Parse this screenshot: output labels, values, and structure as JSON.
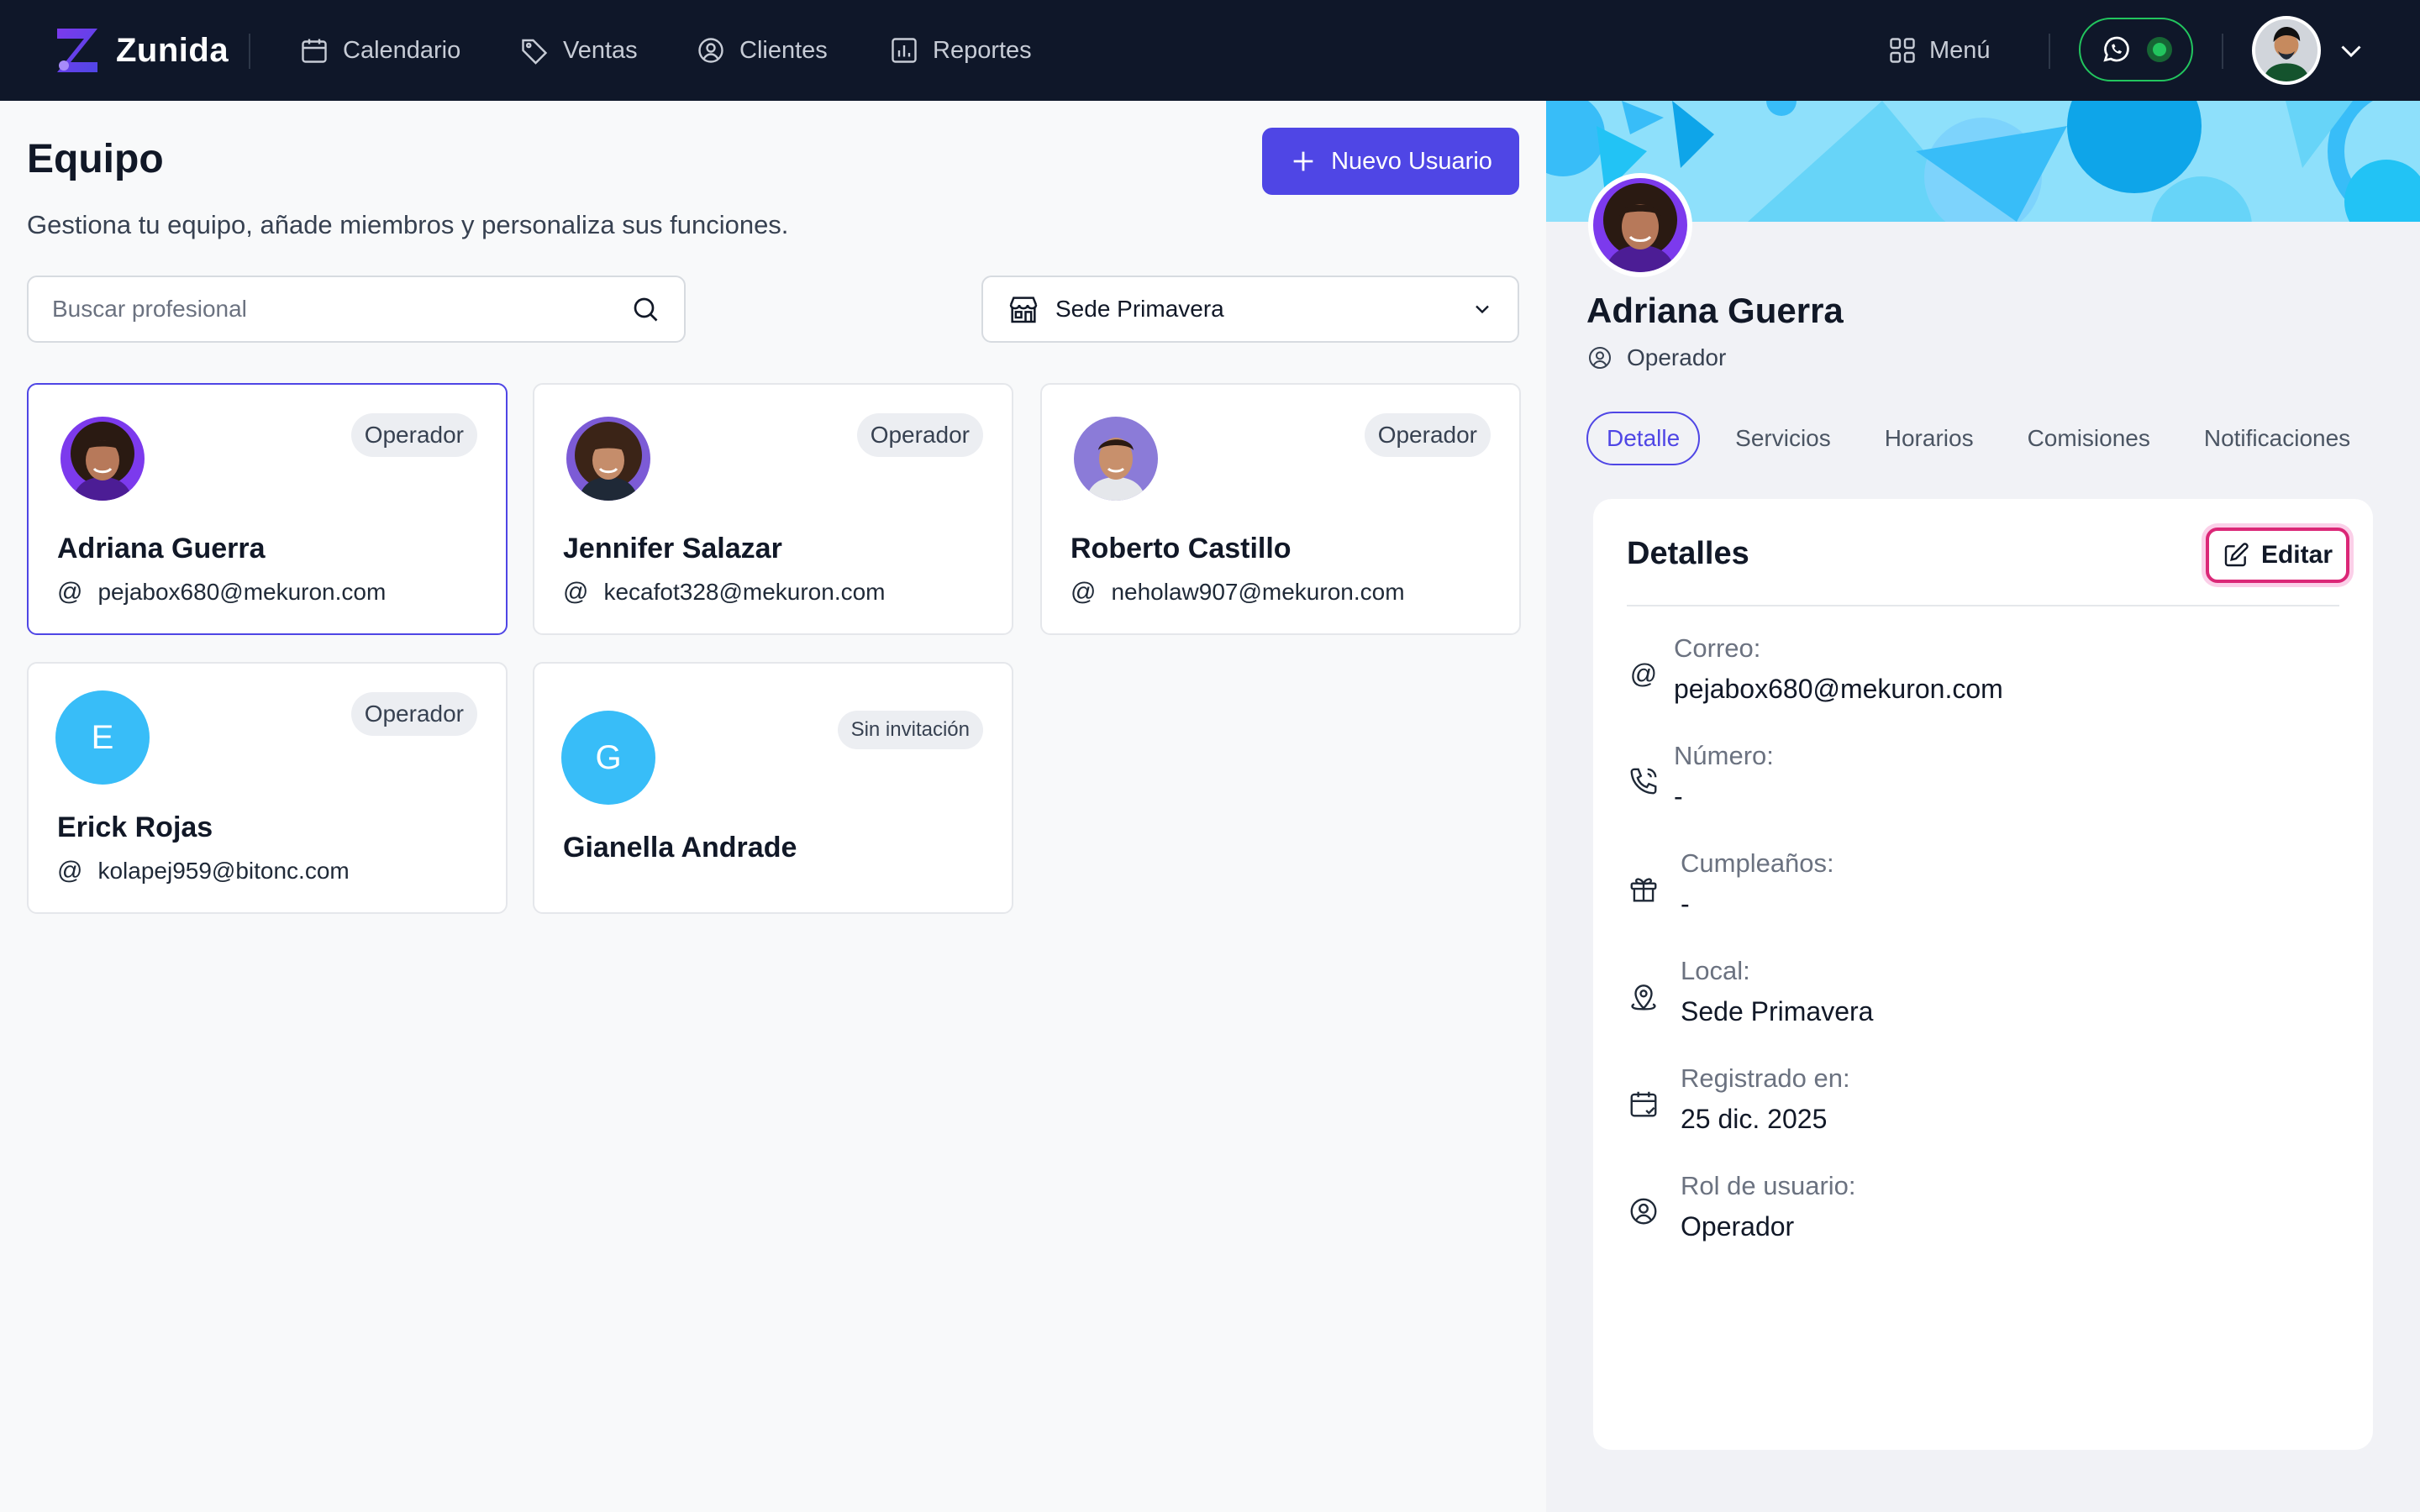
{
  "app": {
    "name": "Zunida",
    "brand_color": "#4f46e5",
    "header_bg": "#0f1729"
  },
  "nav": {
    "items": [
      {
        "label": "Calendario",
        "icon": "calendar-icon"
      },
      {
        "label": "Ventas",
        "icon": "tag-icon"
      },
      {
        "label": "Clientes",
        "icon": "user-circle-icon"
      },
      {
        "label": "Reportes",
        "icon": "bar-chart-icon"
      }
    ],
    "menu_label": "Menú"
  },
  "page": {
    "title": "Equipo",
    "subtitle": "Gestiona tu equipo, añade miembros y personaliza sus funciones.",
    "new_user_label": "Nuevo Usuario",
    "search_placeholder": "Buscar profesional",
    "site_selected": "Sede Primavera"
  },
  "members": [
    {
      "name": "Adriana Guerra",
      "email": "pejabox680@mekuron.com",
      "badge": "Operador",
      "avatar": "photo",
      "selected": true
    },
    {
      "name": "Jennifer Salazar",
      "email": "kecafot328@mekuron.com",
      "badge": "Operador",
      "avatar": "photo",
      "selected": false
    },
    {
      "name": "Roberto Castillo",
      "email": "neholaw907@mekuron.com",
      "badge": "Operador",
      "avatar": "photo",
      "selected": false
    },
    {
      "name": "Erick Rojas",
      "email": "kolapej959@bitonc.com",
      "badge": "Operador",
      "avatar": "E",
      "selected": false
    },
    {
      "name": "Gianella Andrade",
      "email": "",
      "badge": "Sin invitación",
      "avatar": "G",
      "selected": false
    }
  ],
  "profile": {
    "name": "Adriana Guerra",
    "role": "Operador",
    "tabs": [
      "Detalle",
      "Servicios",
      "Horarios",
      "Comisiones",
      "Notificaciones"
    ],
    "active_tab": "Detalle",
    "details_title": "Detalles",
    "edit_label": "Editar",
    "fields": [
      {
        "label": "Correo:",
        "value": "pejabox680@mekuron.com",
        "icon": "at-icon"
      },
      {
        "label": "Número:",
        "value": "-",
        "icon": "phone-icon"
      },
      {
        "label": "Cumpleaños:",
        "value": "-",
        "icon": "gift-icon"
      },
      {
        "label": "Local:",
        "value": "Sede Primavera",
        "icon": "location-pin-icon"
      },
      {
        "label": "Registrado en:",
        "value": "25 dic. 2025",
        "icon": "calendar-icon"
      },
      {
        "label": "Rol de usuario:",
        "value": "Operador",
        "icon": "user-circle-icon"
      }
    ]
  }
}
